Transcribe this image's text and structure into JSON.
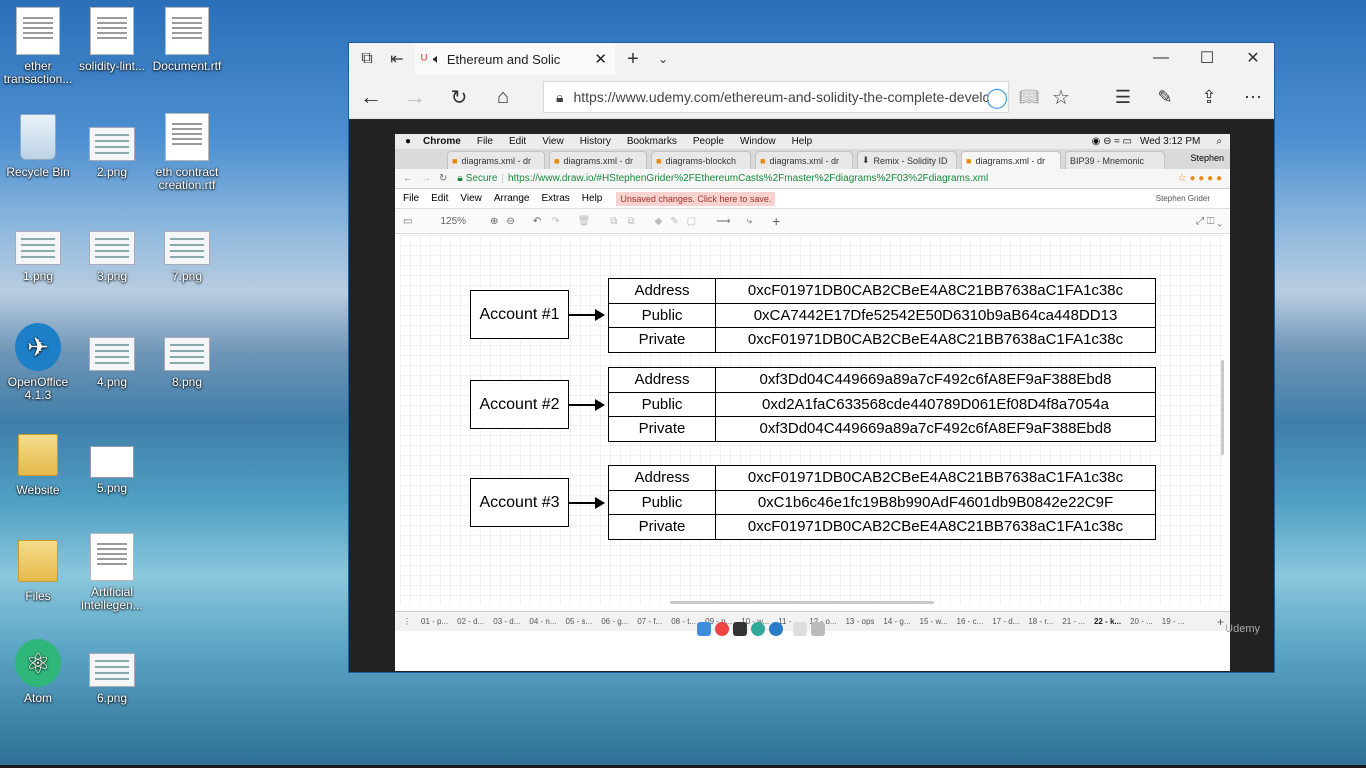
{
  "desktop": {
    "icons": [
      {
        "label": "ether transaction...",
        "type": "doc"
      },
      {
        "label": "solidity-lint...",
        "type": "doc"
      },
      {
        "label": "Document.rtf",
        "type": "doc"
      },
      {
        "label": "Recycle Bin",
        "type": "bin"
      },
      {
        "label": "2.png",
        "type": "png"
      },
      {
        "label": "eth contract creation.rtf",
        "type": "doc"
      },
      {
        "label": "1.png",
        "type": "png"
      },
      {
        "label": "3.png",
        "type": "png"
      },
      {
        "label": "7.png",
        "type": "png"
      },
      {
        "label": "OpenOffice 4.1.3",
        "type": "app"
      },
      {
        "label": "4.png",
        "type": "png"
      },
      {
        "label": "8.png",
        "type": "png"
      },
      {
        "label": "Website",
        "type": "folder"
      },
      {
        "label": "5.png",
        "type": "png"
      },
      {
        "label": "Files",
        "type": "folder"
      },
      {
        "label": "Artificial intellegen...",
        "type": "doc"
      },
      {
        "label": "Atom",
        "type": "app"
      },
      {
        "label": "6.png",
        "type": "png"
      }
    ]
  },
  "edge": {
    "tab_title": "Ethereum and Solic",
    "url": "https://www.udemy.com/ethereum-and-solidity-the-complete-develc",
    "watermark": "Udemy"
  },
  "mac": {
    "menubar": [
      "Chrome",
      "File",
      "Edit",
      "View",
      "History",
      "Bookmarks",
      "People",
      "Window",
      "Help"
    ],
    "clock": "Wed 3:12 PM",
    "tabs": [
      "diagrams.xml - dr",
      "diagrams.xml - dr",
      "diagrams-blockch",
      "diagrams.xml - dr",
      "Remix - Solidity ID",
      "diagrams.xml - dr",
      "BIP39 - Mnemonic"
    ],
    "profile": "Stephen",
    "secure_label": "Secure",
    "url": "https://www.draw.io/#HStephenGrider%2FEthereumCasts%2Fmaster%2Fdiagrams%2F03%2Fdiagrams.xml",
    "drawio_menu": [
      "File",
      "Edit",
      "View",
      "Arrange",
      "Extras",
      "Help"
    ],
    "unsaved": "Unsaved changes. Click here to save.",
    "user": "Stephen Grider",
    "zoom": "125%",
    "pages": [
      "01 - p...",
      "02 - d...",
      "03 - d...",
      "04 - n...",
      "05 - s...",
      "06 - g...",
      "07 - f...",
      "08 - t...",
      "09 - p...",
      "10 - w...",
      "11 - ...",
      "12 - o...",
      "13 - ops",
      "14 - g...",
      "15 - w...",
      "16 - c...",
      "17 - d...",
      "18 - r...",
      "21 - ...",
      "22 - k...",
      "20 - ...",
      "19 - ..."
    ]
  },
  "diagram": {
    "accounts": [
      {
        "label": "Account #1",
        "rows": [
          {
            "key": "Address",
            "value": "0xcF01971DB0CAB2CBeE4A8C21BB7638aC1FA1c38c"
          },
          {
            "key": "Public",
            "value": "0xCA7442E17Dfe52542E50D6310b9aB64ca448DD13"
          },
          {
            "key": "Private",
            "value": "0xcF01971DB0CAB2CBeE4A8C21BB7638aC1FA1c38c"
          }
        ]
      },
      {
        "label": "Account #2",
        "rows": [
          {
            "key": "Address",
            "value": "0xf3Dd04C449669a89a7cF492c6fA8EF9aF388Ebd8"
          },
          {
            "key": "Public",
            "value": "0xd2A1faC633568cde440789D061Ef08D4f8a7054a"
          },
          {
            "key": "Private",
            "value": "0xf3Dd04C449669a89a7cF492c6fA8EF9aF388Ebd8"
          }
        ]
      },
      {
        "label": "Account #3",
        "rows": [
          {
            "key": "Address",
            "value": "0xcF01971DB0CAB2CBeE4A8C21BB7638aC1FA1c38c"
          },
          {
            "key": "Public",
            "value": "0xC1b6c46e1fc19B8b990AdF4601db9B0842e22C9F"
          },
          {
            "key": "Private",
            "value": "0xcF01971DB0CAB2CBeE4A8C21BB7638aC1FA1c38c"
          }
        ]
      }
    ]
  }
}
